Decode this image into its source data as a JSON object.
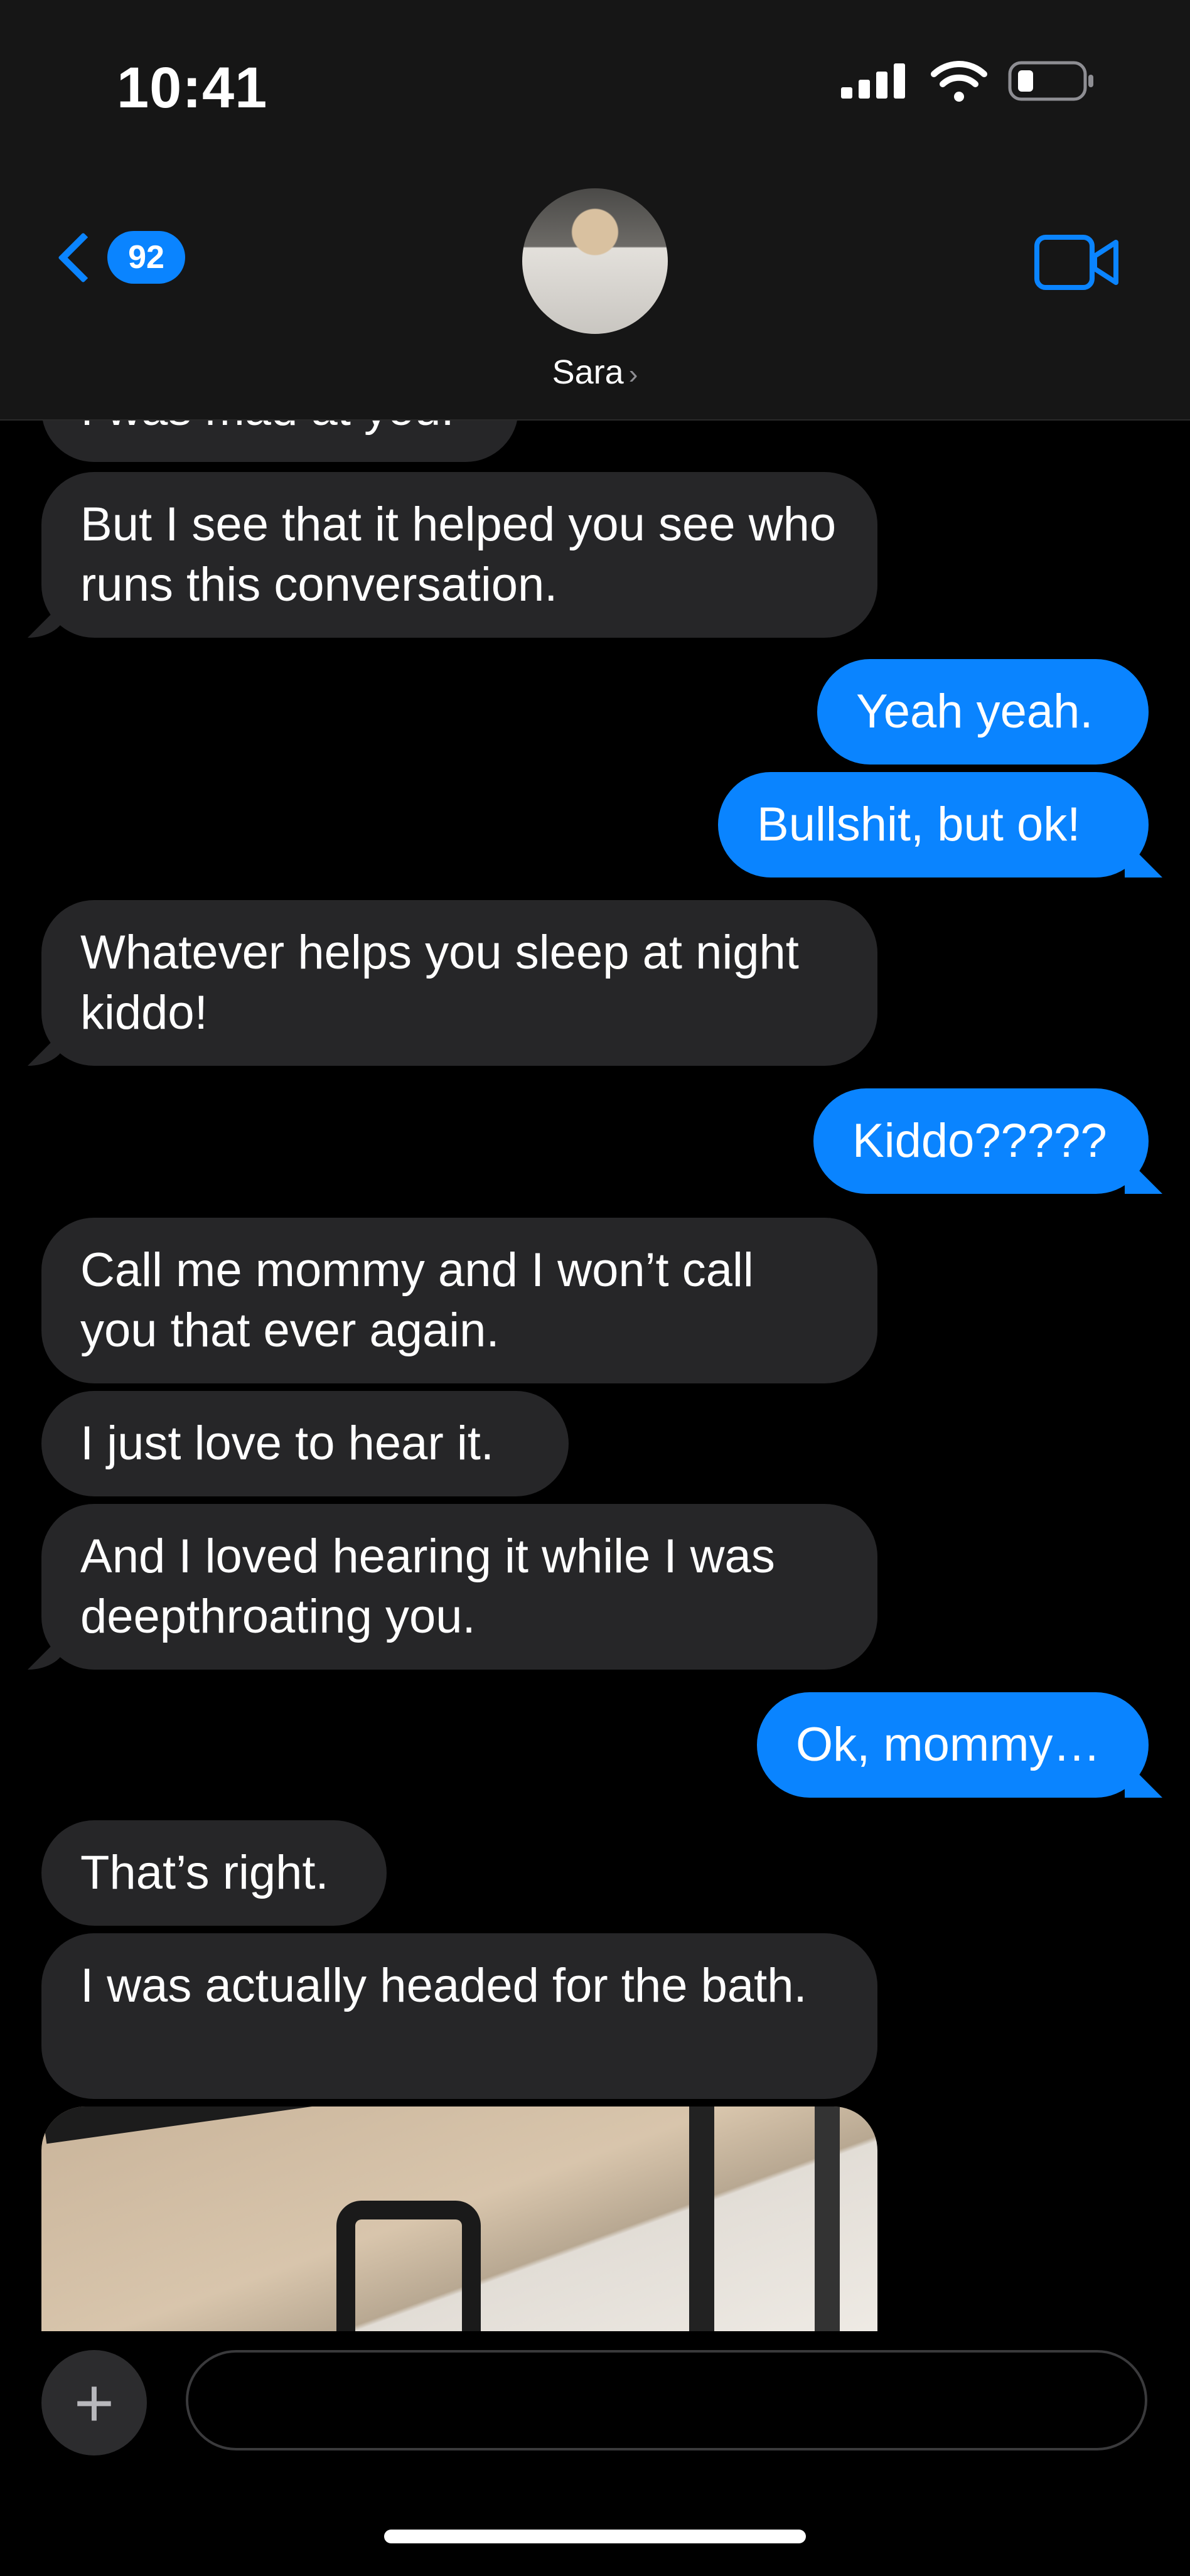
{
  "status_bar": {
    "time": "10:41"
  },
  "header": {
    "back_badge": "92",
    "contact_name": "Sara",
    "contact_chevron": "›",
    "video_icon": "video-camera-icon"
  },
  "messages": [
    {
      "side": "in",
      "text": "I was mad at you."
    },
    {
      "side": "in",
      "text": "But I see that it helped you see who runs this conversation."
    },
    {
      "side": "out",
      "text": "Yeah yeah."
    },
    {
      "side": "out",
      "text": "Bullshit, but ok!"
    },
    {
      "side": "in",
      "text": "Whatever helps you sleep at night kiddo!"
    },
    {
      "side": "out",
      "text": "Kiddo?????"
    },
    {
      "side": "in",
      "text": "Call me mommy and I won’t call you that ever again."
    },
    {
      "side": "in",
      "text": "I just love to hear it."
    },
    {
      "side": "in",
      "text": "And I loved hearing it while I was deepthroating you."
    },
    {
      "side": "out",
      "text": "Ok, mommy…"
    },
    {
      "side": "in",
      "text": "That’s right."
    },
    {
      "side": "in",
      "text": "I was actually headed for the bath."
    }
  ],
  "composer": {
    "plus_label": "+",
    "placeholder": "",
    "mic_icon": "microphone-icon"
  },
  "colors": {
    "accent": "#0a84ff",
    "incoming": "#262628",
    "background": "#000000"
  }
}
